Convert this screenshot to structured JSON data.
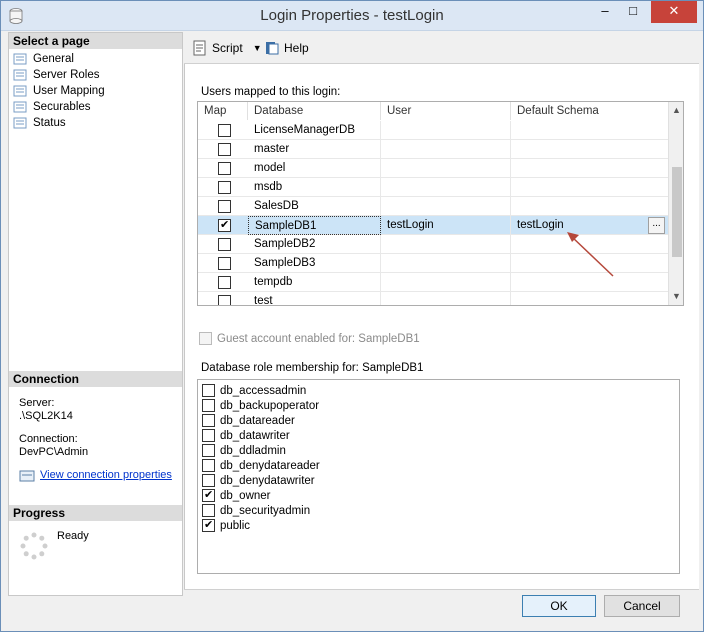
{
  "window": {
    "title": "Login Properties - testLogin"
  },
  "sidebar": {
    "select_header": "Select a page",
    "pages": [
      {
        "label": "General"
      },
      {
        "label": "Server Roles"
      },
      {
        "label": "User Mapping"
      },
      {
        "label": "Securables"
      },
      {
        "label": "Status"
      }
    ],
    "connection_header": "Connection",
    "server_label": "Server:",
    "server_value": ".\\SQL2K14",
    "connection_label": "Connection:",
    "connection_value": "DevPC\\Admin",
    "view_props_link": "View connection properties",
    "progress_header": "Progress",
    "progress_status": "Ready"
  },
  "toolbar": {
    "script_label": "Script",
    "help_label": "Help"
  },
  "mapping": {
    "section_label": "Users mapped to this login:",
    "columns": [
      "Map",
      "Database",
      "User",
      "Default Schema"
    ],
    "rows": [
      {
        "checked": false,
        "database": "LicenseManagerDB",
        "user": "",
        "schema": ""
      },
      {
        "checked": false,
        "database": "master",
        "user": "",
        "schema": ""
      },
      {
        "checked": false,
        "database": "model",
        "user": "",
        "schema": ""
      },
      {
        "checked": false,
        "database": "msdb",
        "user": "",
        "schema": ""
      },
      {
        "checked": false,
        "database": "SalesDB",
        "user": "",
        "schema": ""
      },
      {
        "checked": true,
        "database": "SampleDB1",
        "user": "testLogin",
        "schema": "testLogin",
        "selected": true
      },
      {
        "checked": false,
        "database": "SampleDB2",
        "user": "",
        "schema": ""
      },
      {
        "checked": false,
        "database": "SampleDB3",
        "user": "",
        "schema": ""
      },
      {
        "checked": false,
        "database": "tempdb",
        "user": "",
        "schema": ""
      },
      {
        "checked": false,
        "database": "test",
        "user": "",
        "schema": ""
      }
    ],
    "ellipsis": "...",
    "guest_label": "Guest account enabled for: SampleDB1"
  },
  "roles": {
    "section_label": "Database role membership for: SampleDB1",
    "items": [
      {
        "label": "db_accessadmin",
        "checked": false
      },
      {
        "label": "db_backupoperator",
        "checked": false
      },
      {
        "label": "db_datareader",
        "checked": false
      },
      {
        "label": "db_datawriter",
        "checked": false
      },
      {
        "label": "db_ddladmin",
        "checked": false
      },
      {
        "label": "db_denydatareader",
        "checked": false
      },
      {
        "label": "db_denydatawriter",
        "checked": false
      },
      {
        "label": "db_owner",
        "checked": true
      },
      {
        "label": "db_securityadmin",
        "checked": false
      },
      {
        "label": "public",
        "checked": true
      }
    ]
  },
  "buttons": {
    "ok": "OK",
    "cancel": "Cancel"
  },
  "colors": {
    "selection": "#cce4f7",
    "link": "#0033cc",
    "arrow": "#b5483b",
    "close": "#c7433a"
  }
}
